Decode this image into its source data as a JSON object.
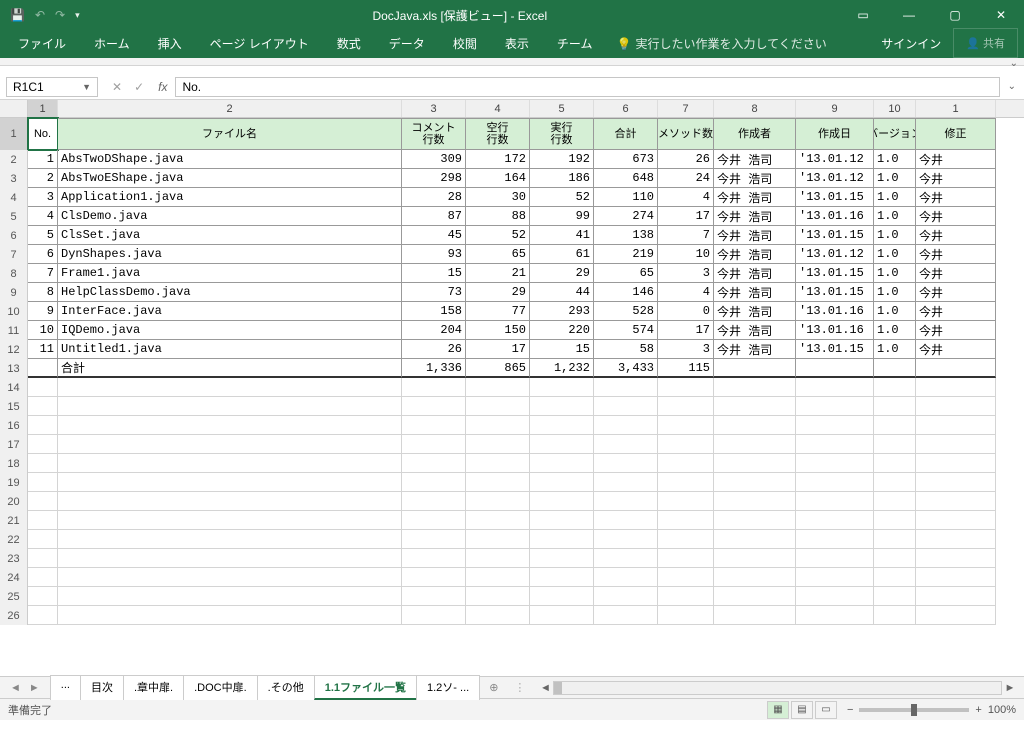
{
  "title": "DocJava.xls  [保護ビュー] - Excel",
  "ribbon": {
    "tabs": [
      "ファイル",
      "ホーム",
      "挿入",
      "ページ レイアウト",
      "数式",
      "データ",
      "校閲",
      "表示",
      "チーム"
    ],
    "tellme": "実行したい作業を入力してください",
    "signin": "サインイン",
    "share": "共有"
  },
  "namebox": "R1C1",
  "formula": "No.",
  "colnums": [
    "1",
    "2",
    "3",
    "4",
    "5",
    "6",
    "7",
    "8",
    "9",
    "10",
    "1"
  ],
  "headers": [
    "No.",
    "ファイル名",
    "コメント\n行数",
    "空行\n行数",
    "実行\n行数",
    "合計",
    "メソッド数",
    "作成者",
    "作成日",
    "バージョン",
    "修正"
  ],
  "rows": [
    {
      "n": "1",
      "file": "AbsTwoDShape.java",
      "c": "309",
      "b": "172",
      "x": "192",
      "t": "673",
      "m": "26",
      "au": "今井 浩司",
      "d": "'13.01.12",
      "v": "1.0",
      "mo": "今井"
    },
    {
      "n": "2",
      "file": "AbsTwoEShape.java",
      "c": "298",
      "b": "164",
      "x": "186",
      "t": "648",
      "m": "24",
      "au": "今井 浩司",
      "d": "'13.01.12",
      "v": "1.0",
      "mo": "今井"
    },
    {
      "n": "3",
      "file": "Application1.java",
      "c": "28",
      "b": "30",
      "x": "52",
      "t": "110",
      "m": "4",
      "au": "今井 浩司",
      "d": "'13.01.15",
      "v": "1.0",
      "mo": "今井"
    },
    {
      "n": "4",
      "file": "ClsDemo.java",
      "c": "87",
      "b": "88",
      "x": "99",
      "t": "274",
      "m": "17",
      "au": "今井 浩司",
      "d": "'13.01.16",
      "v": "1.0",
      "mo": "今井"
    },
    {
      "n": "5",
      "file": "ClsSet.java",
      "c": "45",
      "b": "52",
      "x": "41",
      "t": "138",
      "m": "7",
      "au": "今井 浩司",
      "d": "'13.01.15",
      "v": "1.0",
      "mo": "今井"
    },
    {
      "n": "6",
      "file": "DynShapes.java",
      "c": "93",
      "b": "65",
      "x": "61",
      "t": "219",
      "m": "10",
      "au": "今井 浩司",
      "d": "'13.01.12",
      "v": "1.0",
      "mo": "今井"
    },
    {
      "n": "7",
      "file": "Frame1.java",
      "c": "15",
      "b": "21",
      "x": "29",
      "t": "65",
      "m": "3",
      "au": "今井 浩司",
      "d": "'13.01.15",
      "v": "1.0",
      "mo": "今井"
    },
    {
      "n": "8",
      "file": "HelpClassDemo.java",
      "c": "73",
      "b": "29",
      "x": "44",
      "t": "146",
      "m": "4",
      "au": "今井 浩司",
      "d": "'13.01.15",
      "v": "1.0",
      "mo": "今井"
    },
    {
      "n": "9",
      "file": "InterFace.java",
      "c": "158",
      "b": "77",
      "x": "293",
      "t": "528",
      "m": "0",
      "au": "今井 浩司",
      "d": "'13.01.16",
      "v": "1.0",
      "mo": "今井"
    },
    {
      "n": "10",
      "file": "IQDemo.java",
      "c": "204",
      "b": "150",
      "x": "220",
      "t": "574",
      "m": "17",
      "au": "今井 浩司",
      "d": "'13.01.16",
      "v": "1.0",
      "mo": "今井"
    },
    {
      "n": "11",
      "file": "Untitled1.java",
      "c": "26",
      "b": "17",
      "x": "15",
      "t": "58",
      "m": "3",
      "au": "今井 浩司",
      "d": "'13.01.15",
      "v": "1.0",
      "mo": "今井"
    }
  ],
  "total": {
    "label": "合計",
    "c": "1,336",
    "b": "865",
    "x": "1,232",
    "t": "3,433",
    "m": "115"
  },
  "sheets": [
    "...",
    "目次",
    ".章中扉.",
    ".DOC中扉.",
    ".その他",
    "1.1ファイル一覧",
    "1.2ソ- ..."
  ],
  "active_sheet": "1.1ファイル一覧",
  "status": "準備完了",
  "zoom": "100%"
}
